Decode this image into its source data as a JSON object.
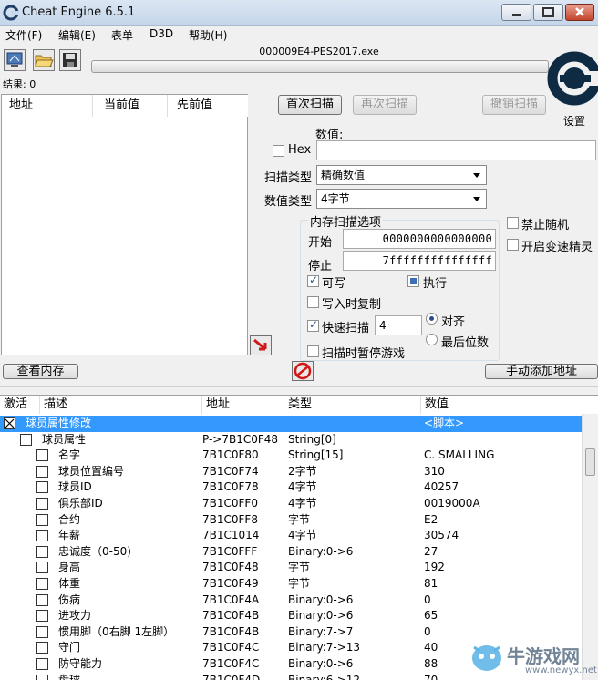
{
  "window": {
    "title": "Cheat Engine 6.5.1"
  },
  "menu": [
    "文件(F)",
    "编辑(E)",
    "表单",
    "D3D",
    "帮助(H)"
  ],
  "toolbar": {
    "process": "000009E4-PES2017.exe"
  },
  "results_label": "结果: 0",
  "found_list": {
    "columns": [
      "地址",
      "当前值",
      "先前值"
    ]
  },
  "logo": {
    "settings_label": "设置"
  },
  "scan": {
    "first_scan": "首次扫描",
    "next_scan": "再次扫描",
    "undo_scan": "撤销扫描",
    "value_label": "数值:",
    "hex_label": "Hex",
    "scan_type_label": "扫描类型",
    "scan_type_value": "精确数值",
    "value_type_label": "数值类型",
    "value_type_value": "4字节"
  },
  "memory_options": {
    "title": "内存扫描选项",
    "start_label": "开始",
    "start_value": "0000000000000000",
    "stop_label": "停止",
    "stop_value": "7fffffffffffffff",
    "writable": "可写",
    "executable": "执行",
    "copy_on_write": "写入时复制",
    "fast_scan": "快速扫描",
    "fast_scan_value": "4",
    "align": "对齐",
    "last_digits": "最后位数",
    "pause_game": "扫描时暂停游戏"
  },
  "right_options": {
    "no_random": "禁止随机",
    "speedhack": "开启变速精灵"
  },
  "bottom_buttons": {
    "view_memory": "查看内存",
    "add_address": "手动添加地址"
  },
  "table": {
    "columns": [
      "激活",
      "描述",
      "地址",
      "类型",
      "数值"
    ],
    "rows": [
      {
        "desc": "球员属性修改",
        "addr": "",
        "type": "",
        "value": "<脚本>",
        "level": 0,
        "selected": true
      },
      {
        "desc": "球员属性",
        "addr": "P->7B1C0F48",
        "type": "String[0]",
        "value": "",
        "level": 1
      },
      {
        "desc": "名字",
        "addr": "7B1C0F80",
        "type": "String[15]",
        "value": "C. SMALLING",
        "level": 2
      },
      {
        "desc": "球员位置编号",
        "addr": "7B1C0F74",
        "type": "2字节",
        "value": "310",
        "level": 2
      },
      {
        "desc": "球员ID",
        "addr": "7B1C0F78",
        "type": "4字节",
        "value": "40257",
        "level": 2
      },
      {
        "desc": "俱乐部ID",
        "addr": "7B1C0FF0",
        "type": "4字节",
        "value": "0019000A",
        "level": 2
      },
      {
        "desc": "合约",
        "addr": "7B1C0FF8",
        "type": "字节",
        "value": "E2",
        "level": 2
      },
      {
        "desc": "年薪",
        "addr": "7B1C1014",
        "type": "4字节",
        "value": "30574",
        "level": 2
      },
      {
        "desc": "忠诚度（0-50)",
        "addr": "7B1C0FFF",
        "type": "Binary:0->6",
        "value": "27",
        "level": 2
      },
      {
        "desc": "身高",
        "addr": "7B1C0F48",
        "type": "字节",
        "value": "192",
        "level": 2
      },
      {
        "desc": "体重",
        "addr": "7B1C0F49",
        "type": "字节",
        "value": "81",
        "level": 2
      },
      {
        "desc": "伤病",
        "addr": "7B1C0F4A",
        "type": "Binary:0->6",
        "value": "0",
        "level": 2
      },
      {
        "desc": "进攻力",
        "addr": "7B1C0F4B",
        "type": "Binary:0->6",
        "value": "65",
        "level": 2
      },
      {
        "desc": "惯用脚（0右脚 1左脚）",
        "addr": "7B1C0F4B",
        "type": "Binary:7->7",
        "value": "0",
        "level": 2
      },
      {
        "desc": "守门",
        "addr": "7B1C0F4C",
        "type": "Binary:7->13",
        "value": "40",
        "level": 2
      },
      {
        "desc": "防守能力",
        "addr": "7B1C0F4C",
        "type": "Binary:0->6",
        "value": "88",
        "level": 2
      },
      {
        "desc": "盘球",
        "addr": "7B1C0F4D",
        "type": "Binary:6->12",
        "value": "70",
        "level": 2
      }
    ]
  },
  "watermark": {
    "text": "牛游戏网",
    "url": "www.newyx.net"
  }
}
